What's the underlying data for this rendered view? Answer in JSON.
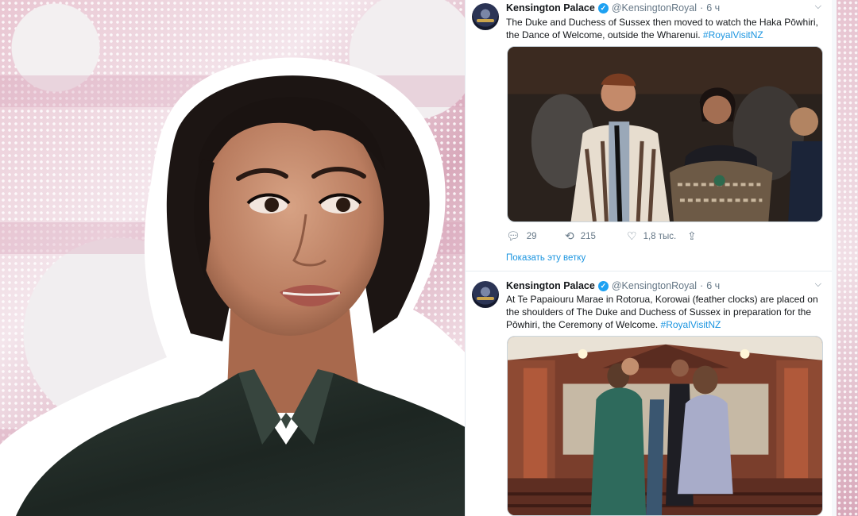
{
  "tweets": [
    {
      "author": "Kensington Palace",
      "handle": "@KensingtonRoyal",
      "separator": "·",
      "time": "6 ч",
      "text": "The Duke and Duchess of Sussex then moved to watch the Haka Pōwhiri, the Dance of Welcome, outside the Wharenui. ",
      "hashtag": "#RoyalVisitNZ",
      "replies": "29",
      "retweets": "215",
      "likes": "1,8 тыс.",
      "show_thread": "Показать эту ветку"
    },
    {
      "author": "Kensington Palace",
      "handle": "@KensingtonRoyal",
      "separator": "·",
      "time": "6 ч",
      "text": "At Te Papaiouru Marae in Rotorua, Korowai (feather clocks) are placed on the shoulders of The Duke and Duchess of Sussex in preparation for the Pōwhiri, the Ceremony of Welcome. ",
      "hashtag": "#RoyalVisitNZ"
    }
  ],
  "icons": {
    "verified": "verified-check-icon",
    "reply": "reply-icon",
    "retweet": "retweet-icon",
    "like": "heart-icon",
    "share": "share-icon",
    "more": "chevron-down-icon"
  },
  "colors": {
    "link": "#1b95e0",
    "verified": "#1da1f2",
    "text": "#14171a",
    "muted": "#657786"
  }
}
